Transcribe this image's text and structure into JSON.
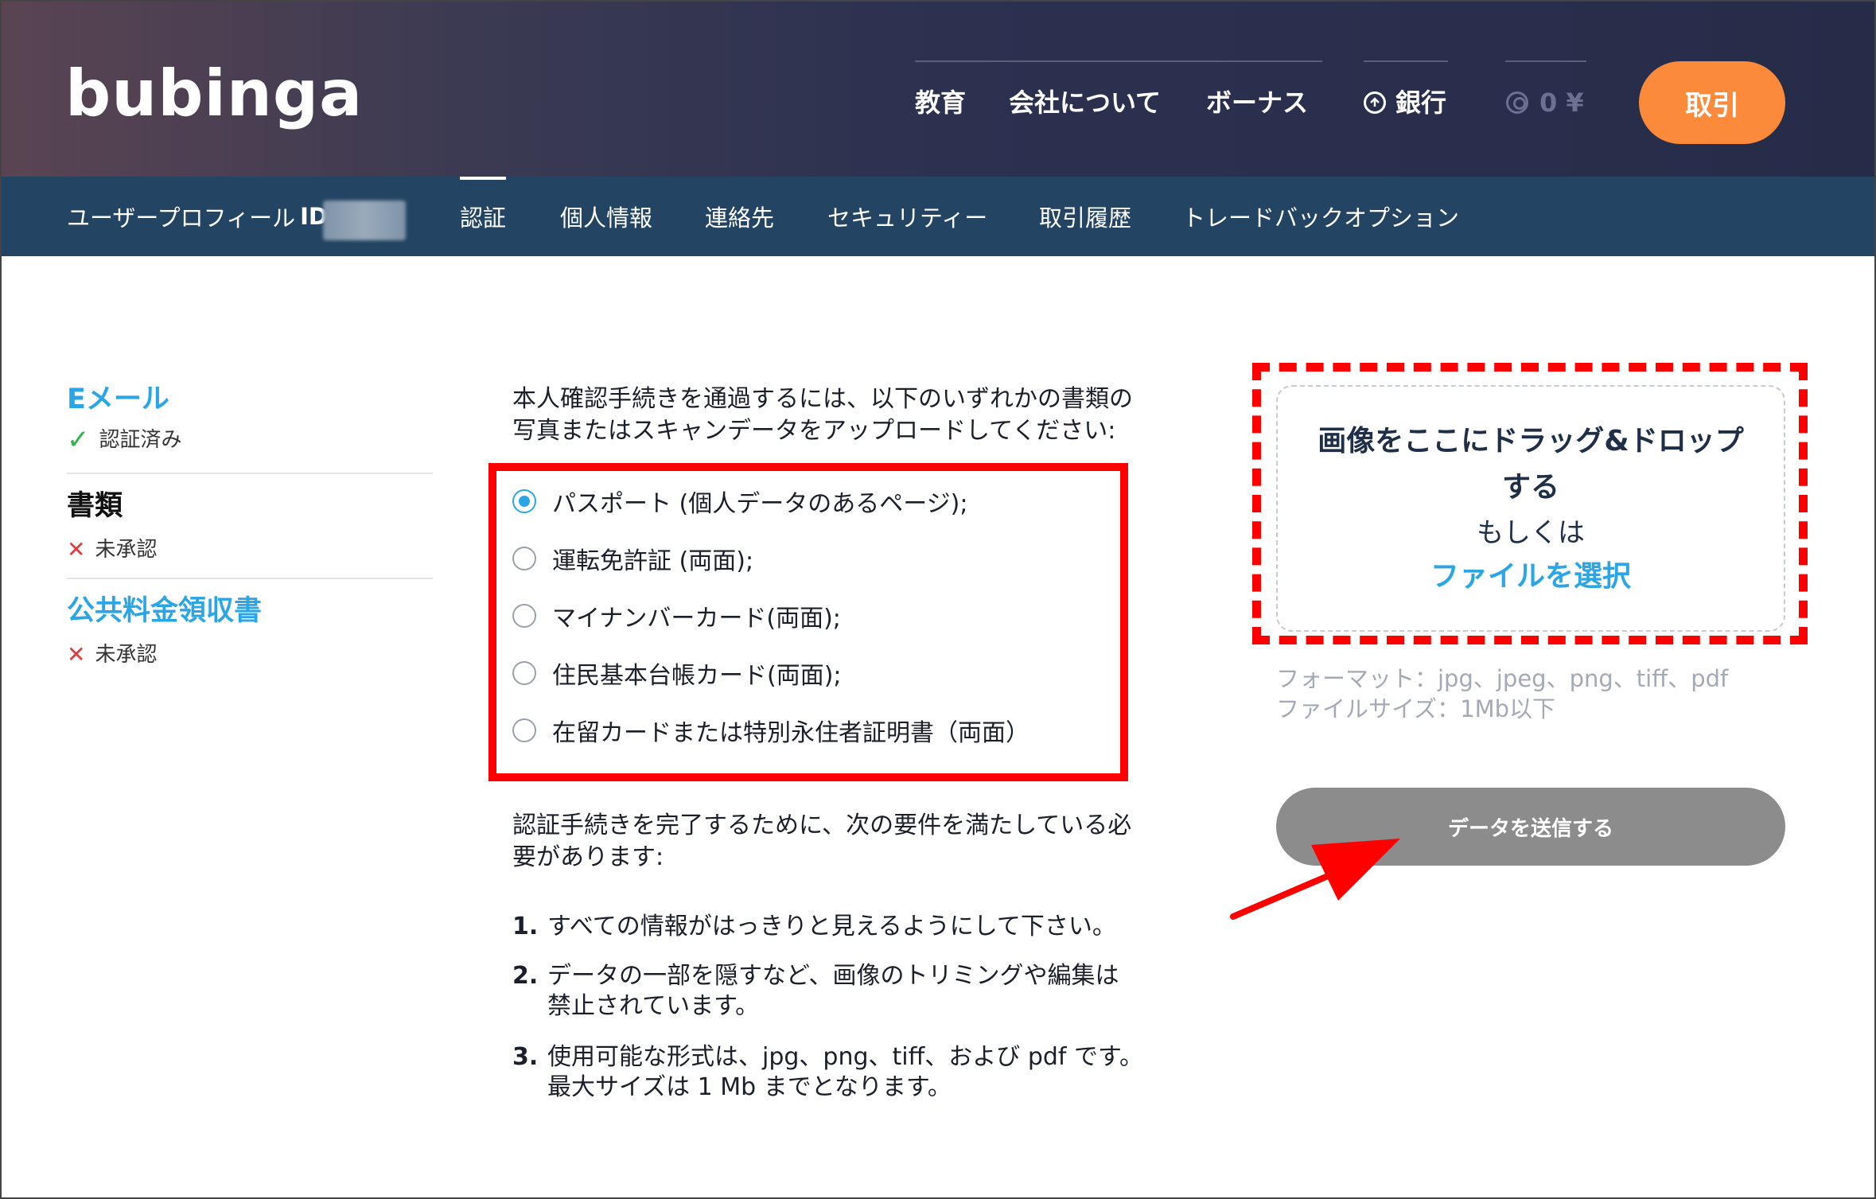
{
  "header": {
    "logo": "bubinga",
    "nav": [
      "教育",
      "会社について",
      "ボーナス"
    ],
    "bank_label": "銀行",
    "balance": "0 ¥",
    "trade_button": "取引"
  },
  "subnav": {
    "profile_label": "ユーザープロフィール",
    "id_label": "ID:",
    "tabs": [
      "認証",
      "個人情報",
      "連絡先",
      "セキュリティー",
      "取引履歴",
      "トレードバックオプション"
    ]
  },
  "sidebar": {
    "items": [
      {
        "title": "Eメール",
        "status": "認証済み"
      },
      {
        "title": "書類",
        "status": "未承認"
      },
      {
        "title": "公共料金領収書",
        "status": "未承認"
      }
    ]
  },
  "main": {
    "intro_line1": "本人確認手続きを通過するには、以下のいずれかの書類の",
    "intro_line2": "写真またはスキャンデータをアップロードしてください:",
    "options": [
      "パスポート (個人データのあるページ);",
      "運転免許証 (両面);",
      "マイナンバーカード(両面);",
      "住民基本台帳カード(両面);",
      "在留カードまたは特別永住者証明書（両面）"
    ],
    "selected_option": 0,
    "requirements_intro_line1": "認証手続きを完了するために、次の要件を満たしている必",
    "requirements_intro_line2": "要があります:",
    "requirements": [
      {
        "num": "1.",
        "line1": "すべての情報がはっきりと見えるようにして下さい。",
        "line2": ""
      },
      {
        "num": "2.",
        "line1": "データの一部を隠すなど、画像のトリミングや編集は",
        "line2": "禁止されています。"
      },
      {
        "num": "3.",
        "line1": "使用可能な形式は、jpg、png、tiff、および pdf です。",
        "line2": "最大サイズは 1 Mb までとなります。"
      }
    ]
  },
  "upload": {
    "drop_title": "画像をここにドラッグ&ドロップする",
    "or_text": "もしくは",
    "choose_file": "ファイルを選択",
    "formats": "フォーマット：jpg、jpeg、png、tiff、pdf",
    "max_size": "ファイルサイズ：1Mb以下",
    "submit_button": "データを送信する"
  },
  "colors": {
    "accent_blue": "#2aa6e6",
    "orange": "#fb8b3b",
    "subnav": "#234462",
    "highlight_red": "#ff0000"
  }
}
